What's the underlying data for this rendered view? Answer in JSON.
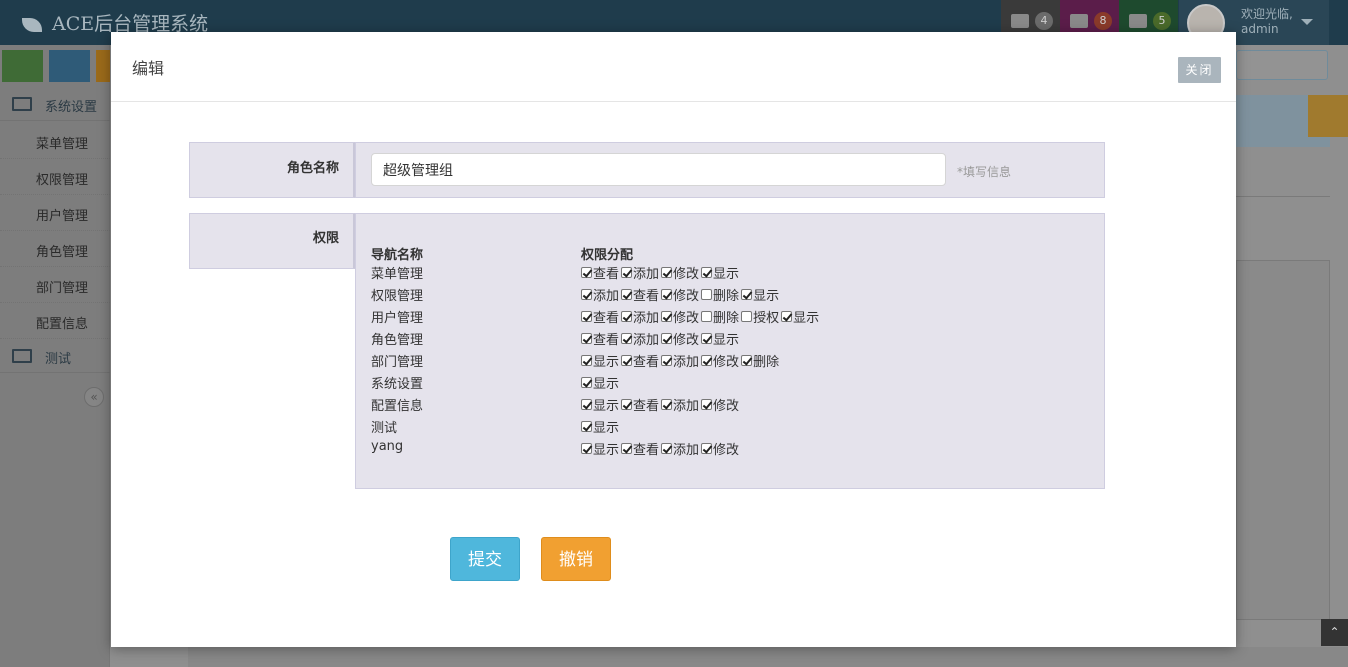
{
  "app": {
    "brand": "ACE后台管理系统",
    "notifications": [
      {
        "icon": "tasks-icon",
        "count": "4",
        "bg": "#3a3a3a",
        "badge": "#6b6b6b"
      },
      {
        "icon": "bell-icon",
        "count": "8",
        "bg": "#5b1d4a",
        "badge": "#8a3a2a"
      },
      {
        "icon": "envelope-icon",
        "count": "5",
        "bg": "#1e4a2e",
        "badge": "#4a6a2a"
      }
    ],
    "user": {
      "welcome": "欢迎光临,",
      "name": "admin"
    }
  },
  "sidebar": {
    "shortcuts": [
      {
        "icon": "signal-icon",
        "color": "#3f6b36"
      },
      {
        "icon": "pencil-icon",
        "color": "#2f5b78"
      },
      {
        "icon": "users-icon",
        "color": "#9a6a1a"
      }
    ],
    "sections": [
      {
        "label": "系统设置",
        "icon": "desktop-icon",
        "items": [
          "菜单管理",
          "权限管理",
          "用户管理",
          "角色管理",
          "部门管理",
          "配置信息"
        ]
      },
      {
        "label": "测试",
        "icon": "desktop-icon",
        "items": []
      }
    ],
    "collapse_glyph": "«"
  },
  "modal": {
    "title": "编辑",
    "close_label": "关闭",
    "role_name_label": "角色名称",
    "role_name_value": "超级管理组",
    "role_name_hint": "*填写信息",
    "permissions_label": "权限",
    "col_nav": "导航名称",
    "col_perm": "权限分配",
    "rows": [
      {
        "name": "菜单管理",
        "perms": [
          {
            "label": "查看",
            "checked": true
          },
          {
            "label": "添加",
            "checked": true
          },
          {
            "label": "修改",
            "checked": true
          },
          {
            "label": "显示",
            "checked": true
          }
        ]
      },
      {
        "name": "权限管理",
        "perms": [
          {
            "label": "添加",
            "checked": true
          },
          {
            "label": "查看",
            "checked": true
          },
          {
            "label": "修改",
            "checked": true
          },
          {
            "label": "删除",
            "checked": false
          },
          {
            "label": "显示",
            "checked": true
          }
        ]
      },
      {
        "name": "用户管理",
        "perms": [
          {
            "label": "查看",
            "checked": true
          },
          {
            "label": "添加",
            "checked": true
          },
          {
            "label": "修改",
            "checked": true
          },
          {
            "label": "删除",
            "checked": false
          },
          {
            "label": "授权",
            "checked": false
          },
          {
            "label": "显示",
            "checked": true
          }
        ]
      },
      {
        "name": "角色管理",
        "perms": [
          {
            "label": "查看",
            "checked": true
          },
          {
            "label": "添加",
            "checked": true
          },
          {
            "label": "修改",
            "checked": true
          },
          {
            "label": "显示",
            "checked": true
          }
        ]
      },
      {
        "name": "部门管理",
        "perms": [
          {
            "label": "显示",
            "checked": true
          },
          {
            "label": "查看",
            "checked": true
          },
          {
            "label": "添加",
            "checked": true
          },
          {
            "label": "修改",
            "checked": true
          },
          {
            "label": "删除",
            "checked": true
          }
        ]
      },
      {
        "name": "系统设置",
        "perms": [
          {
            "label": "显示",
            "checked": true
          }
        ]
      },
      {
        "name": "配置信息",
        "perms": [
          {
            "label": "显示",
            "checked": true
          },
          {
            "label": "查看",
            "checked": true
          },
          {
            "label": "添加",
            "checked": true
          },
          {
            "label": "修改",
            "checked": true
          }
        ]
      },
      {
        "name": "测试",
        "perms": [
          {
            "label": "显示",
            "checked": true
          }
        ]
      },
      {
        "name": "yang",
        "perms": [
          {
            "label": "显示",
            "checked": true
          },
          {
            "label": "查看",
            "checked": true
          },
          {
            "label": "添加",
            "checked": true
          },
          {
            "label": "修改",
            "checked": true
          }
        ]
      }
    ],
    "submit_label": "提交",
    "cancel_label": "撤销"
  }
}
